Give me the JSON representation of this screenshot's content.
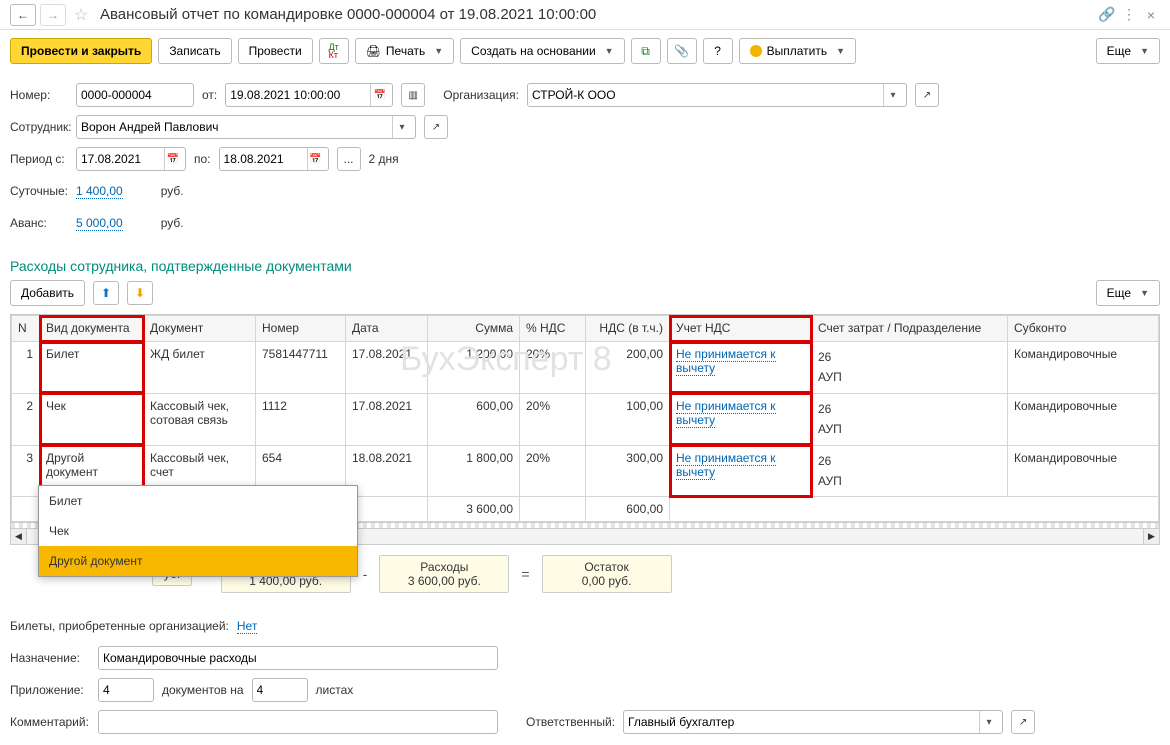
{
  "title": "Авансовый отчет по командировке 0000-000004 от 19.08.2021 10:00:00",
  "toolbar": {
    "post_close": "Провести и закрыть",
    "record": "Записать",
    "post": "Провести",
    "print": "Печать",
    "create_based": "Создать на основании",
    "pay_out": "Выплатить",
    "more": "Еще"
  },
  "header": {
    "number_lbl": "Номер:",
    "number": "0000-000004",
    "from_lbl": "от:",
    "date": "19.08.2021 10:00:00",
    "org_lbl": "Организация:",
    "org": "СТРОЙ-К ООО",
    "employee_lbl": "Сотрудник:",
    "employee": "Ворон Андрей Павлович",
    "period_from_lbl": "Период с:",
    "period_from": "17.08.2021",
    "period_to_lbl": "по:",
    "period_to": "18.08.2021",
    "period_ellipsis": "...",
    "period_days": "2 дня",
    "perdiem_lbl": "Суточные:",
    "perdiem_val": "1 400,00",
    "currency": "руб.",
    "advance_lbl": "Аванс:",
    "advance_val": "5 000,00"
  },
  "section_title": "Расходы сотрудника, подтвержденные документами",
  "grid_toolbar": {
    "add": "Добавить",
    "more": "Еще"
  },
  "grid": {
    "cols": {
      "n": "N",
      "doc_type": "Вид документа",
      "doc": "Документ",
      "docnum": "Номер",
      "date": "Дата",
      "sum": "Сумма",
      "vat_rate": "% НДС",
      "vat_incl": "НДС (в т.ч.)",
      "vat_acct": "Учет НДС",
      "acct_dep": "Счет затрат / Подразделение",
      "subconto": "Субконто"
    },
    "rows": [
      {
        "n": "1",
        "doc_type": "Билет",
        "doc": "ЖД билет",
        "docnum": "7581447711",
        "date": "17.08.2021",
        "sum": "1 200,00",
        "vat_rate": "20%",
        "vat_incl": "200,00",
        "vat_acct": "Не принимается к вычету",
        "acct": "26",
        "dep": "АУП",
        "subconto": "Командировочные"
      },
      {
        "n": "2",
        "doc_type": "Чек",
        "doc": "Кассовый чек, сотовая связь",
        "docnum": "1112",
        "date": "17.08.2021",
        "sum": "600,00",
        "vat_rate": "20%",
        "vat_incl": "100,00",
        "vat_acct": "Не принимается к вычету",
        "acct": "26",
        "dep": "АУП",
        "subconto": "Командировочные"
      },
      {
        "n": "3",
        "doc_type": "Другой документ",
        "doc": "Кассовый чек, счет",
        "docnum": "654",
        "date": "18.08.2021",
        "sum": "1 800,00",
        "vat_rate": "20%",
        "vat_incl": "300,00",
        "vat_acct": "Не принимается к вычету",
        "acct": "26",
        "dep": "АУП",
        "subconto": "Командировочные"
      }
    ],
    "totals": {
      "sum": "3 600,00",
      "vat_incl": "600,00"
    }
  },
  "dropdown": {
    "options": [
      "Билет",
      "Чек",
      "Другой документ"
    ],
    "selected": "Другой документ"
  },
  "summary": {
    "box1_top": "",
    "box1_bot": "уб.",
    "perdiem_top": "Суточные",
    "perdiem_bot": "1 400,00 руб.",
    "expenses_top": "Расходы",
    "expenses_bot": "3 600,00 руб.",
    "balance_top": "Остаток",
    "balance_bot": "0,00 руб."
  },
  "footer": {
    "tickets_lbl": "Билеты, приобретенные организацией:",
    "tickets_val": "Нет",
    "purpose_lbl": "Назначение:",
    "purpose_val": "Командировочные расходы",
    "attach_lbl": "Приложение:",
    "attach_docs": "4",
    "attach_docs_lbl": "документов на",
    "attach_sheets": "4",
    "attach_sheets_lbl": "листах",
    "comment_lbl": "Комментарий:",
    "resp_lbl": "Ответственный:",
    "resp_val": "Главный бухгалтер"
  }
}
